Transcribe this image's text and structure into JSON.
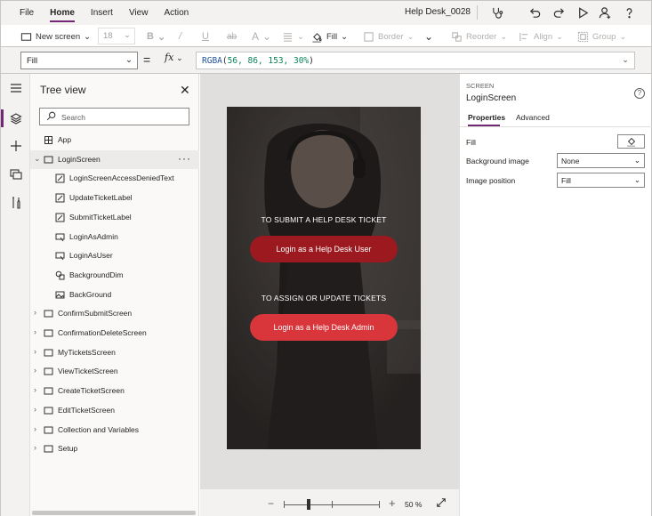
{
  "menu": {
    "items": [
      "File",
      "Home",
      "Insert",
      "View",
      "Action"
    ],
    "active_index": 1,
    "app_title": "Help Desk_0028"
  },
  "top_icons": [
    "stethoscope-icon",
    "undo-icon",
    "redo-icon",
    "play-icon",
    "account-icon",
    "help-icon"
  ],
  "ribbon": {
    "new_screen": "New screen",
    "font_size": "18",
    "fill": "Fill",
    "border": "Border",
    "reorder": "Reorder",
    "align": "Align",
    "group": "Group"
  },
  "formula_bar": {
    "property": "Fill",
    "fx": "fx",
    "formula_fn": "RGBA",
    "formula_args": "56, 86, 153, 30%"
  },
  "rail_icons": [
    "hamburger-icon",
    "layers-icon",
    "plus-icon",
    "media-icon",
    "tools-icon"
  ],
  "tree_view": {
    "title": "Tree view",
    "search_placeholder": "Search",
    "items": [
      {
        "label": "App",
        "icon": "app-icon",
        "level": 0,
        "expandable": false
      },
      {
        "label": "LoginScreen",
        "icon": "screen-icon",
        "level": 0,
        "expandable": true,
        "expanded": true,
        "selected": true
      },
      {
        "label": "LoginScreenAccessDeniedText",
        "icon": "label-icon",
        "level": 1
      },
      {
        "label": "UpdateTicketLabel",
        "icon": "label-icon",
        "level": 1
      },
      {
        "label": "SubmitTicketLabel",
        "icon": "label-icon",
        "level": 1
      },
      {
        "label": "LoginAsAdmin",
        "icon": "button-icon",
        "level": 1
      },
      {
        "label": "LoginAsUser",
        "icon": "button-icon",
        "level": 1
      },
      {
        "label": "BackgroundDim",
        "icon": "shape-icon",
        "level": 1
      },
      {
        "label": "BackGround",
        "icon": "image-icon",
        "level": 1
      },
      {
        "label": "ConfirmSubmitScreen",
        "icon": "screen-icon",
        "level": 0,
        "expandable": true
      },
      {
        "label": "ConfirmationDeleteScreen",
        "icon": "screen-icon",
        "level": 0,
        "expandable": true
      },
      {
        "label": "MyTicketsScreen",
        "icon": "screen-icon",
        "level": 0,
        "expandable": true
      },
      {
        "label": "ViewTicketScreen",
        "icon": "screen-icon",
        "level": 0,
        "expandable": true
      },
      {
        "label": "CreateTicketScreen",
        "icon": "screen-icon",
        "level": 0,
        "expandable": true
      },
      {
        "label": "EditTicketScreen",
        "icon": "screen-icon",
        "level": 0,
        "expandable": true
      },
      {
        "label": "Collection and Variables",
        "icon": "screen-icon",
        "level": 0,
        "expandable": true
      },
      {
        "label": "Setup",
        "icon": "screen-icon",
        "level": 0,
        "expandable": true
      }
    ]
  },
  "canvas": {
    "submit_caption": "TO SUBMIT A HELP DESK TICKET",
    "user_button": "Login as a Help Desk User",
    "assign_caption": "TO ASSIGN OR UPDATE TICKETS",
    "admin_button": "Login as a Help Desk Admin",
    "zoom": "50 %"
  },
  "properties": {
    "kind": "SCREEN",
    "name": "LoginScreen",
    "tabs": [
      "Properties",
      "Advanced"
    ],
    "active_tab": 0,
    "fill_label": "Fill",
    "bg_image_label": "Background image",
    "bg_image_value": "None",
    "img_pos_label": "Image position",
    "img_pos_value": "Fill"
  },
  "colors": {
    "accent": "#742774",
    "user_button": "#9c1a1f",
    "admin_button": "#d8363b"
  }
}
